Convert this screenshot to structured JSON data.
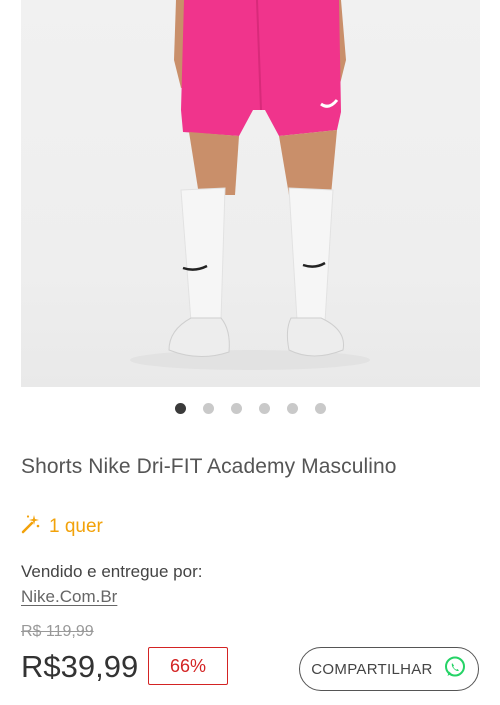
{
  "product": {
    "title": "Shorts Nike Dri-FIT Academy Masculino",
    "wants": "1 quer",
    "sold_by_label": "Vendido e entregue por:",
    "seller": "Nike.Com.Br",
    "old_price": "R$ 119,99",
    "price": "R$39,99",
    "discount": "66%",
    "share_label": "COMPARTILHAR"
  },
  "gallery": {
    "total_images": 6,
    "active_index": 0
  },
  "colors": {
    "accent_orange": "#f2a20a",
    "discount_red": "#d32323",
    "whatsapp_green": "#25d366",
    "shorts_pink": "#f0348c"
  },
  "icons": {
    "wants": "sparkle-wand-icon",
    "share": "whatsapp-icon"
  }
}
